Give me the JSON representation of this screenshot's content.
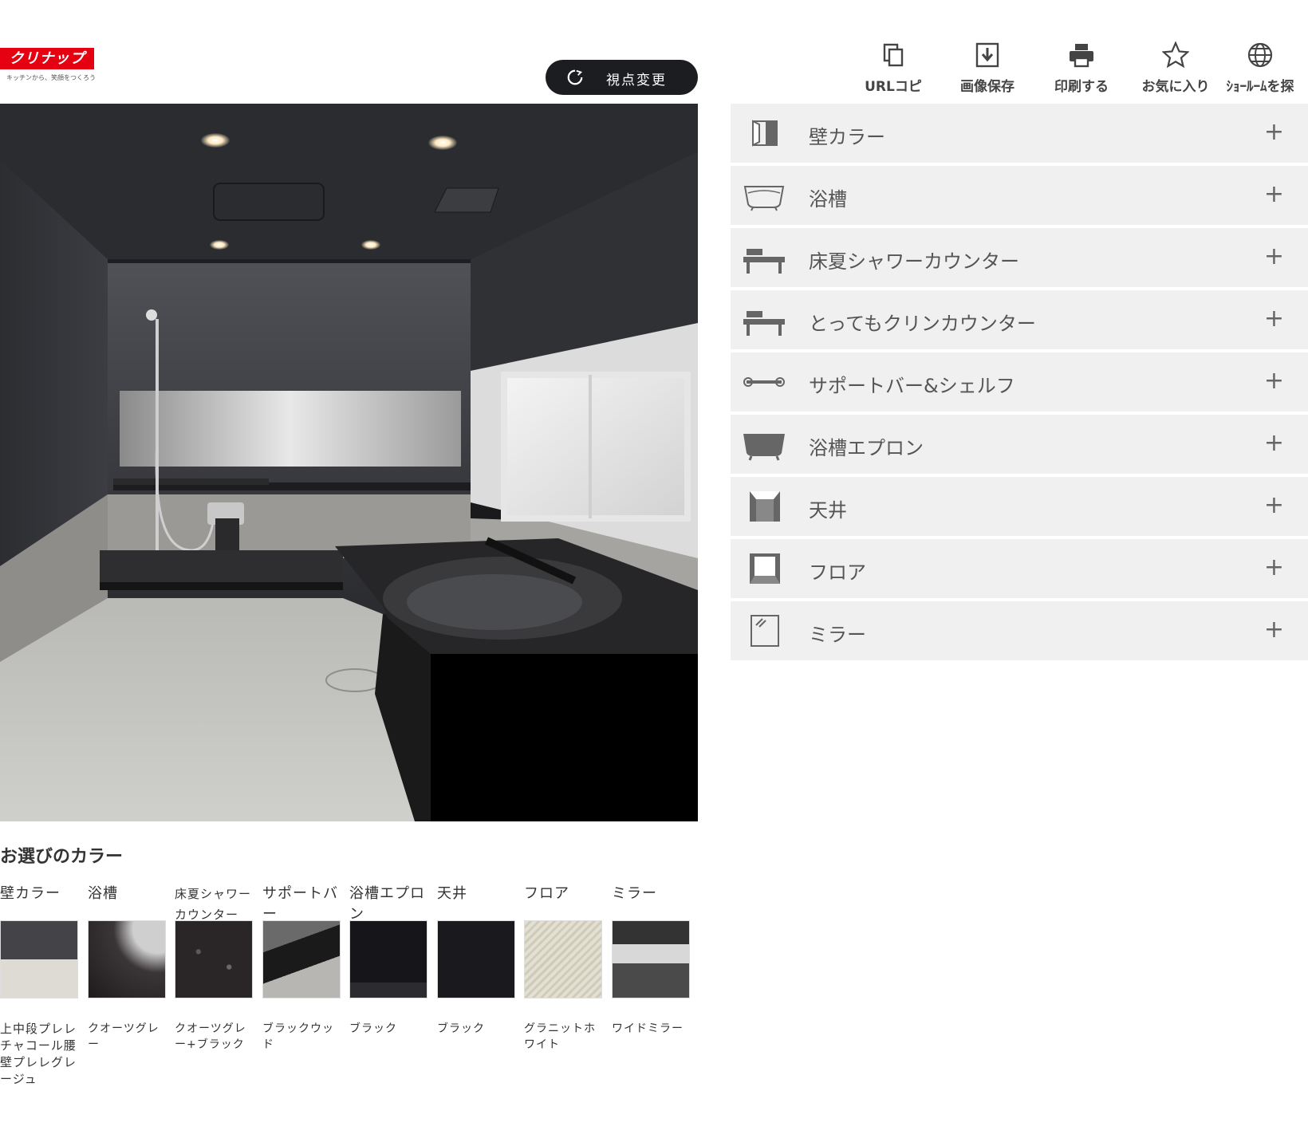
{
  "brand": {
    "logo_text": "クリナップ",
    "tagline": "キッチンから、笑顔をつくろう"
  },
  "view_button": {
    "label": "視点変更"
  },
  "toolbar": [
    {
      "label": "URLコピ",
      "icon": "copy-icon"
    },
    {
      "label": "画像保存",
      "icon": "download-icon"
    },
    {
      "label": "印刷する",
      "icon": "print-icon"
    },
    {
      "label": "お気に入り",
      "icon": "star-icon"
    },
    {
      "label": "ｼｮｰﾙｰﾑを探",
      "icon": "globe-icon"
    }
  ],
  "menu": [
    {
      "label": "壁カラー",
      "icon": "wall-icon"
    },
    {
      "label": "浴槽",
      "icon": "bathtub-icon"
    },
    {
      "label": "床夏シャワーカウンター",
      "icon": "counter-icon"
    },
    {
      "label": "とってもクリンカウンター",
      "icon": "counter-icon"
    },
    {
      "label": "サポートバー&シェルフ",
      "icon": "bar-icon"
    },
    {
      "label": "浴槽エプロン",
      "icon": "apron-icon"
    },
    {
      "label": "天井",
      "icon": "ceiling-icon"
    },
    {
      "label": "フロア",
      "icon": "floor-icon"
    },
    {
      "label": "ミラー",
      "icon": "mirror-icon"
    }
  ],
  "expand_symbol": "+",
  "selected": {
    "title": "お選びのカラー",
    "items": [
      {
        "category": "壁カラー",
        "value": "上中段プレレチャコール腰壁プレレグレージュ"
      },
      {
        "category": "浴槽",
        "value": "クオーツグレー"
      },
      {
        "category": "床夏シャワーカウンター",
        "value": "クオーツグレー+ブラック"
      },
      {
        "category": "サポートバー",
        "value": "ブラックウッド"
      },
      {
        "category": "浴槽エプロン",
        "value": "ブラック"
      },
      {
        "category": "天井",
        "value": "ブラック"
      },
      {
        "category": "フロア",
        "value": "グラニットホワイト"
      },
      {
        "category": "ミラー",
        "value": "ワイドミラー"
      }
    ]
  }
}
